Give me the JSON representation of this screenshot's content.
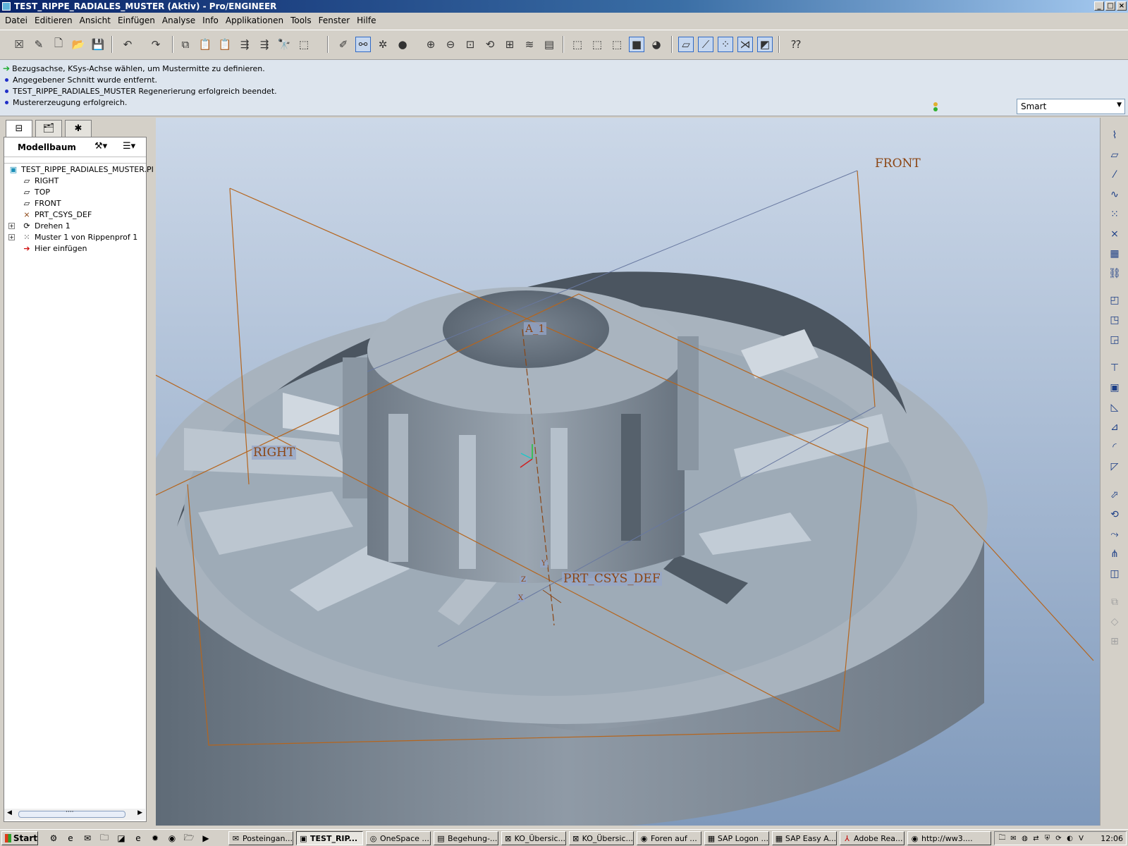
{
  "window": {
    "title": "TEST_RIPPE_RADIALES_MUSTER (Aktiv) - Pro/ENGINEER",
    "minimize": "_",
    "maximize": "□",
    "close": "×"
  },
  "menubar": {
    "items": [
      "Datei",
      "Editieren",
      "Ansicht",
      "Einfügen",
      "Analyse",
      "Info",
      "Applikationen",
      "Tools",
      "Fenster",
      "Hilfe"
    ]
  },
  "toolbar": {
    "icons": [
      "close-window-icon",
      "edit-icon",
      "new-file-icon",
      "open-folder-icon",
      "save-icon",
      "undo-icon",
      "redo-icon",
      "copy-icon",
      "paste-icon",
      "paste-special-icon",
      "regenerate-icon",
      "regenerate-manager-icon",
      "find-icon",
      "select-box-icon",
      "sketch-icon",
      "datum-display-icon",
      "spin-center-icon",
      "shading-icon",
      "zoom-in-icon",
      "zoom-out-icon",
      "refit-icon",
      "reorient-icon",
      "saved-views-icon",
      "layers-icon",
      "view-manager-icon",
      "wireframe-icon",
      "hidden-line-icon",
      "no-hidden-icon",
      "shaded-icon",
      "enhanced-realism-icon",
      "datum-planes-icon",
      "datum-axes-icon",
      "datum-points-icon",
      "coord-systems-icon",
      "annotations-icon",
      "context-help-icon"
    ]
  },
  "messages": [
    {
      "kind": "prompt",
      "text": "Bezugsachse, KSys-Achse wählen, um Mustermitte zu definieren."
    },
    {
      "kind": "info",
      "text": "Angegebener Schnitt wurde entfernt."
    },
    {
      "kind": "info",
      "text": "TEST_RIPPE_RADIALES_MUSTER Regenerierung erfolgreich beendet."
    },
    {
      "kind": "info",
      "text": "Mustererzeugung erfolgreich."
    }
  ],
  "selection_filter": {
    "value": "Smart"
  },
  "navigator": {
    "tabs": [
      "model-tree-tab-icon",
      "folder-browser-tab-icon",
      "favorites-tab-icon"
    ],
    "title": "Modellbaum",
    "tree": [
      {
        "label": "TEST_RIPPE_RADIALES_MUSTER.PI",
        "icon": "part-icon",
        "expandable": false
      },
      {
        "label": "RIGHT",
        "icon": "datum-plane-icon",
        "expandable": false
      },
      {
        "label": "TOP",
        "icon": "datum-plane-icon",
        "expandable": false
      },
      {
        "label": "FRONT",
        "icon": "datum-plane-icon",
        "expandable": false
      },
      {
        "label": "PRT_CSYS_DEF",
        "icon": "coordinate-system-icon",
        "expandable": false
      },
      {
        "label": "Drehen 1",
        "icon": "revolve-icon",
        "expandable": true
      },
      {
        "label": "Muster 1 von Rippenprof 1",
        "icon": "pattern-icon",
        "expandable": true
      },
      {
        "label": "Hier einfügen",
        "icon": "insert-here-arrow-icon",
        "expandable": false
      }
    ],
    "scrollbar_grip": "····"
  },
  "viewport": {
    "datum_labels": {
      "front": "FRONT",
      "right": "RIGHT",
      "axis": "A_1",
      "csys": "PRT_CSYS_DEF",
      "csys_y": "Y",
      "csys_z": "Z",
      "csys_x": "X"
    },
    "colors": {
      "background_top": "#ccd8e8",
      "background_bottom": "#7f99bb",
      "model": "#9aa6b2",
      "datum": "#b5651d"
    }
  },
  "right_toolbar": {
    "icons": [
      "datum-plane-tool-icon",
      "datum-plane-icon",
      "datum-axis-icon",
      "datum-curve-icon",
      "datum-point-icon",
      "coord-system-icon",
      "analysis-feature-icon",
      "external-reference-icon",
      "create-sketch-icon",
      "intent-reference-icon",
      "coordinate-icon",
      "hole-icon",
      "shell-icon",
      "rib-icon",
      "draft-icon",
      "round-icon",
      "chamfer-icon",
      "extrude-icon",
      "revolve-icon",
      "sweep-icon",
      "blend-icon",
      "mirror-icon",
      "merge-icon",
      "trim-icon",
      "pattern-icon"
    ]
  },
  "taskbar": {
    "start": "Start",
    "apps": [
      {
        "label": "Posteingan...",
        "icon": "email-icon",
        "active": false
      },
      {
        "label": "TEST_RIP...",
        "icon": "proe-icon",
        "active": true
      },
      {
        "label": "OneSpace ...",
        "icon": "onespace-icon",
        "active": false
      },
      {
        "label": "Begehung-...",
        "icon": "document-icon",
        "active": false
      },
      {
        "label": "KO_Übersic...",
        "icon": "excel-icon",
        "active": false
      },
      {
        "label": "KO_Übersic...",
        "icon": "excel-icon",
        "active": false
      },
      {
        "label": "Foren auf ...",
        "icon": "firefox-icon",
        "active": false
      },
      {
        "label": "SAP Logon ...",
        "icon": "sap-icon",
        "active": false
      },
      {
        "label": "SAP Easy A...",
        "icon": "sap-icon",
        "active": false
      },
      {
        "label": "Adobe Rea...",
        "icon": "adobe-icon",
        "active": false
      },
      {
        "label": "http://ww3....",
        "icon": "firefox-icon",
        "active": false
      }
    ],
    "clock": "12:06"
  }
}
